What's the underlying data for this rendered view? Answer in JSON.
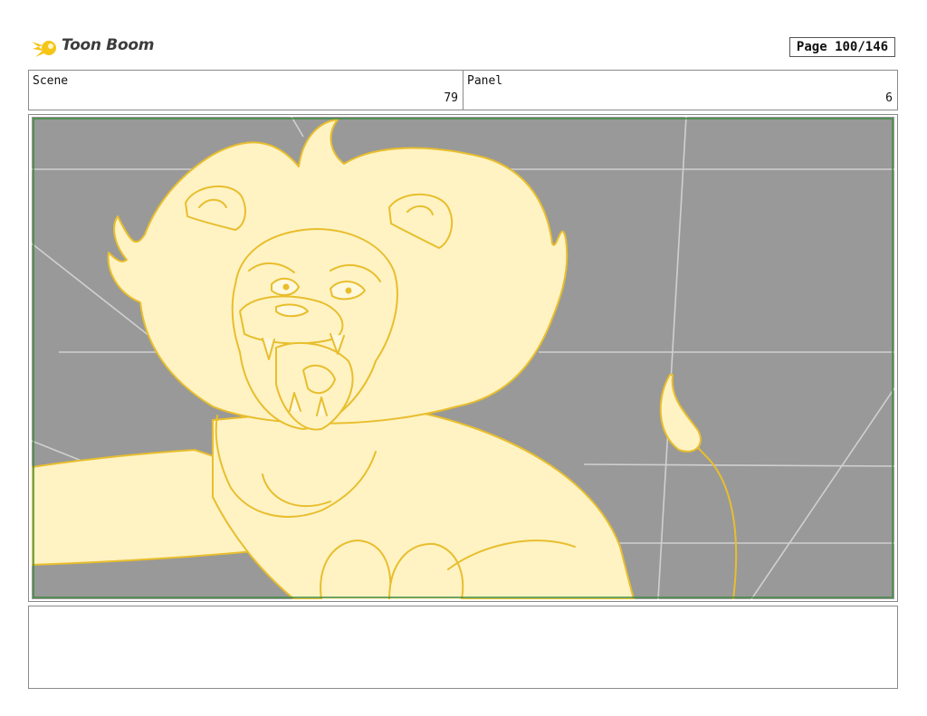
{
  "brand": {
    "name": "Toon Boom",
    "accent_color": "#f5c518",
    "icon": "toon-boom-logo-icon"
  },
  "page": {
    "label": "Page 100/146"
  },
  "header": {
    "scene_label": "Scene",
    "scene_value": "79",
    "panel_label": "Panel",
    "panel_value": "6"
  },
  "panel": {
    "background_color": "#999999",
    "line_color": "#e8be2d",
    "fill_color": "#fff3c4",
    "safe_frame_color": "#3f8a3f"
  },
  "notes": {
    "text": ""
  }
}
